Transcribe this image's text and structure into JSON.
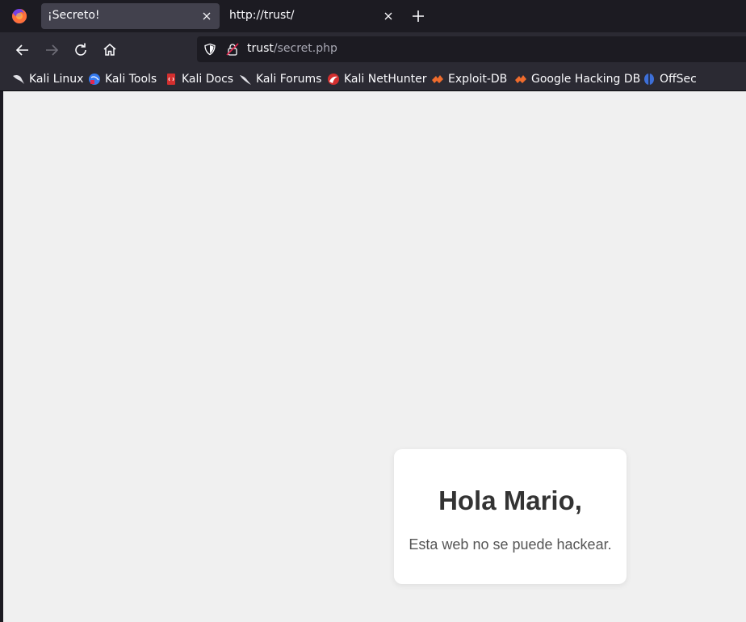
{
  "browser": {
    "tabs": [
      {
        "title": "¡Secreto!",
        "active": true
      },
      {
        "title": "http://trust/",
        "active": false
      }
    ],
    "url": {
      "host": "trust",
      "path": "/secret.php"
    },
    "bookmarks": [
      {
        "label": "Kali Linux",
        "icon": "kali-dragon-icon"
      },
      {
        "label": "Kali Tools",
        "icon": "kali-tools-icon"
      },
      {
        "label": "Kali Docs",
        "icon": "kali-docs-icon"
      },
      {
        "label": "Kali Forums",
        "icon": "kali-forums-icon"
      },
      {
        "label": "Kali NetHunter",
        "icon": "nethunter-icon"
      },
      {
        "label": "Exploit-DB",
        "icon": "exploit-db-icon"
      },
      {
        "label": "Google Hacking DB",
        "icon": "ghdb-icon"
      },
      {
        "label": "OffSec",
        "icon": "offsec-icon"
      }
    ]
  },
  "page": {
    "heading": "Hola Mario,",
    "message": "Esta web no se puede hackear."
  },
  "colors": {
    "tabbar_bg": "#1c1b22",
    "toolbar_bg": "#2b2a33",
    "active_tab_bg": "#42414d",
    "page_bg": "#f0f0f0",
    "card_bg": "#ffffff"
  }
}
